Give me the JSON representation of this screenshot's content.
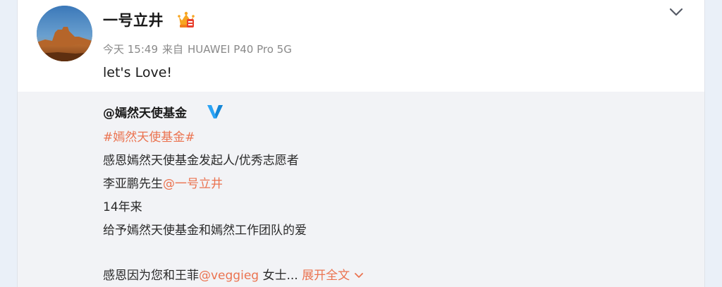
{
  "post": {
    "username": "一号立井",
    "time": "今天 15:49",
    "source_prefix": "来自",
    "source_device": "HUAWEI P40 Pro 5G",
    "text": "let's Love!",
    "badge_icon": "vip-crown-icon",
    "menu_icon": "chevron-down-icon"
  },
  "repost": {
    "author": "@嫣然天使基金",
    "verified_icon": "verified-v-icon",
    "hashtag": "#嫣然天使基金#",
    "line1": "感恩嫣然天使基金发起人/优秀志愿者",
    "line2_text": "李亚鹏先生",
    "line2_mention": "@一号立井",
    "line3": "14年来",
    "line4": "给予嫣然天使基金和嫣然工作团队的爱",
    "line5_text": "感恩因为您和王菲",
    "line5_mention": "@veggieg",
    "line5_suffix": " 女士...",
    "expand_label": "展开全文"
  },
  "colors": {
    "link": "#eb7350",
    "verified": "#2aa3f5",
    "repost_bg": "#f2f3f6"
  }
}
